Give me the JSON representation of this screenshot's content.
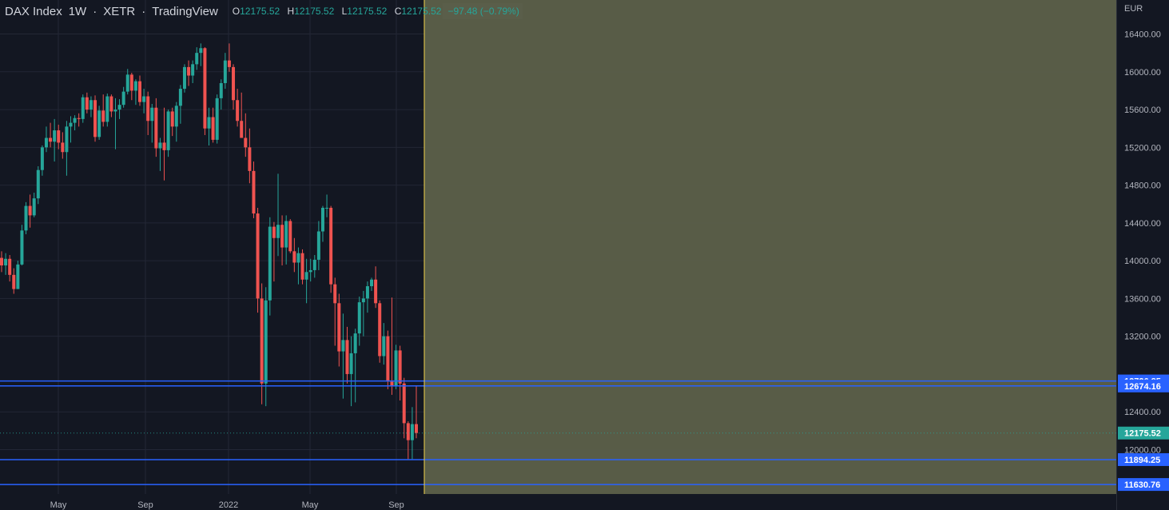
{
  "header": {
    "symbol": "DAX Index",
    "interval": "1W",
    "exchange": "XETR",
    "source": "TradingView",
    "open_label": "O",
    "open": "12175.52",
    "high_label": "H",
    "high": "12175.52",
    "low_label": "L",
    "low": "12175.52",
    "close_label": "C",
    "close": "12175.52",
    "change": "−97.48 (−0.79%)"
  },
  "colors": {
    "background": "#131722",
    "up": "#26a69a",
    "down": "#ef5350",
    "highlight_zone": "#5a5e48",
    "level_line": "#2962ff",
    "crosshair": "#f0d24a",
    "text": "#d1d4dc"
  },
  "chart_data": {
    "type": "candlestick",
    "currency": "EUR",
    "ylim": [
      11530,
      16760
    ],
    "y_ticks": [
      "16400.00",
      "16000.00",
      "15600.00",
      "15200.00",
      "14800.00",
      "14400.00",
      "14000.00",
      "13600.00",
      "13200.00",
      "12400.00",
      "12000.00"
    ],
    "x_ticks": [
      "May",
      "Sep",
      "2022",
      "May",
      "Sep"
    ],
    "price_levels": [
      "12726.85",
      "12674.16",
      "11894.25",
      "11630.76"
    ],
    "last_price": "12175.52",
    "candles": [
      [
        14030,
        14100,
        13880,
        13950
      ],
      [
        13950,
        14080,
        13850,
        14020
      ],
      [
        14020,
        14060,
        13780,
        13850
      ],
      [
        13850,
        13920,
        13650,
        13700
      ],
      [
        13700,
        14000,
        13700,
        13960
      ],
      [
        13960,
        14380,
        13950,
        14320
      ],
      [
        14320,
        14620,
        14280,
        14580
      ],
      [
        14580,
        14700,
        14350,
        14480
      ],
      [
        14480,
        14720,
        14460,
        14660
      ],
      [
        14660,
        15000,
        14600,
        14960
      ],
      [
        14960,
        15220,
        14900,
        15200
      ],
      [
        15200,
        15420,
        15150,
        15300
      ],
      [
        15300,
        15460,
        15200,
        15260
      ],
      [
        15260,
        15500,
        15050,
        15380
      ],
      [
        15380,
        15440,
        15180,
        15250
      ],
      [
        15250,
        15360,
        15080,
        15150
      ],
      [
        15150,
        15480,
        14900,
        15420
      ],
      [
        15420,
        15530,
        15250,
        15460
      ],
      [
        15460,
        15540,
        15380,
        15510
      ],
      [
        15510,
        15560,
        15420,
        15500
      ],
      [
        15500,
        15760,
        15460,
        15730
      ],
      [
        15730,
        15780,
        15560,
        15600
      ],
      [
        15600,
        15740,
        15520,
        15700
      ],
      [
        15700,
        15750,
        15260,
        15310
      ],
      [
        15310,
        15640,
        15280,
        15590
      ],
      [
        15590,
        15760,
        15420,
        15470
      ],
      [
        15470,
        15770,
        15420,
        15740
      ],
      [
        15740,
        15760,
        15520,
        15580
      ],
      [
        15580,
        15720,
        15180,
        15600
      ],
      [
        15600,
        15710,
        15500,
        15650
      ],
      [
        15650,
        15840,
        15620,
        15790
      ],
      [
        15790,
        16030,
        15760,
        15970
      ],
      [
        15970,
        15990,
        15700,
        15800
      ],
      [
        15800,
        15920,
        15650,
        15900
      ],
      [
        15900,
        15960,
        15640,
        15680
      ],
      [
        15680,
        15820,
        15560,
        15740
      ],
      [
        15740,
        15790,
        15330,
        15480
      ],
      [
        15480,
        15660,
        15250,
        15620
      ],
      [
        15620,
        15720,
        15100,
        15190
      ],
      [
        15190,
        15300,
        14950,
        15250
      ],
      [
        15250,
        15620,
        14850,
        15170
      ],
      [
        15170,
        15600,
        15100,
        15580
      ],
      [
        15580,
        15620,
        15320,
        15420
      ],
      [
        15420,
        15680,
        15260,
        15640
      ],
      [
        15640,
        15860,
        15450,
        15820
      ],
      [
        15820,
        16080,
        15780,
        16050
      ],
      [
        16050,
        16120,
        15850,
        15960
      ],
      [
        15960,
        16120,
        15880,
        16080
      ],
      [
        16080,
        16260,
        16020,
        16200
      ],
      [
        16200,
        16300,
        16060,
        16250
      ],
      [
        16250,
        16260,
        15330,
        15400
      ],
      [
        15400,
        15620,
        15220,
        15520
      ],
      [
        15520,
        15620,
        15250,
        15280
      ],
      [
        15280,
        15760,
        15240,
        15720
      ],
      [
        15720,
        15920,
        15600,
        15880
      ],
      [
        15880,
        16200,
        15820,
        16120
      ],
      [
        16120,
        16300,
        16000,
        16050
      ],
      [
        16050,
        16080,
        15600,
        15700
      ],
      [
        15700,
        15820,
        15420,
        15480
      ],
      [
        15480,
        15780,
        15300,
        15300
      ],
      [
        15300,
        15560,
        15100,
        15200
      ],
      [
        15200,
        15400,
        14820,
        14950
      ],
      [
        14950,
        15050,
        14450,
        14500
      ],
      [
        14500,
        14560,
        13450,
        13600
      ],
      [
        13600,
        13760,
        12480,
        12700
      ],
      [
        12700,
        13720,
        12460,
        13580
      ],
      [
        13580,
        14460,
        13420,
        14360
      ],
      [
        14360,
        14410,
        13780,
        14240
      ],
      [
        14240,
        14920,
        14050,
        14380
      ],
      [
        14380,
        14480,
        13950,
        14140
      ],
      [
        14140,
        14480,
        13960,
        14420
      ],
      [
        14420,
        14440,
        14080,
        14100
      ],
      [
        14100,
        14240,
        13880,
        13980
      ],
      [
        13980,
        14140,
        13750,
        14080
      ],
      [
        14080,
        14120,
        13750,
        13800
      ],
      [
        13800,
        14020,
        13550,
        13880
      ],
      [
        13880,
        14020,
        13780,
        13900
      ],
      [
        13900,
        14060,
        13820,
        14010
      ],
      [
        14010,
        14420,
        13900,
        14310
      ],
      [
        14310,
        14580,
        14200,
        14560
      ],
      [
        14560,
        14700,
        14460,
        14560
      ],
      [
        14560,
        14580,
        13660,
        13750
      ],
      [
        13750,
        13820,
        13100,
        13550
      ],
      [
        13550,
        13650,
        12880,
        13040
      ],
      [
        13040,
        13440,
        12540,
        13160
      ],
      [
        13160,
        13300,
        12700,
        12800
      ],
      [
        12800,
        13200,
        12460,
        13020
      ],
      [
        13020,
        13280,
        12500,
        13230
      ],
      [
        13230,
        13620,
        13100,
        13560
      ],
      [
        13560,
        13680,
        13200,
        13600
      ],
      [
        13600,
        13780,
        13450,
        13730
      ],
      [
        13730,
        13820,
        13680,
        13800
      ],
      [
        13800,
        13940,
        13500,
        13550
      ],
      [
        13550,
        13580,
        12920,
        12990
      ],
      [
        12990,
        13340,
        12900,
        13200
      ],
      [
        13200,
        13260,
        12640,
        12720
      ],
      [
        12720,
        13610,
        12580,
        12680
      ],
      [
        12680,
        13110,
        12640,
        13050
      ],
      [
        13050,
        13100,
        12520,
        12700
      ],
      [
        12700,
        12760,
        12120,
        12280
      ],
      [
        12280,
        12300,
        11900,
        12100
      ],
      [
        12100,
        12450,
        11900,
        12270
      ],
      [
        12270,
        12680,
        12120,
        12175.52
      ]
    ]
  }
}
